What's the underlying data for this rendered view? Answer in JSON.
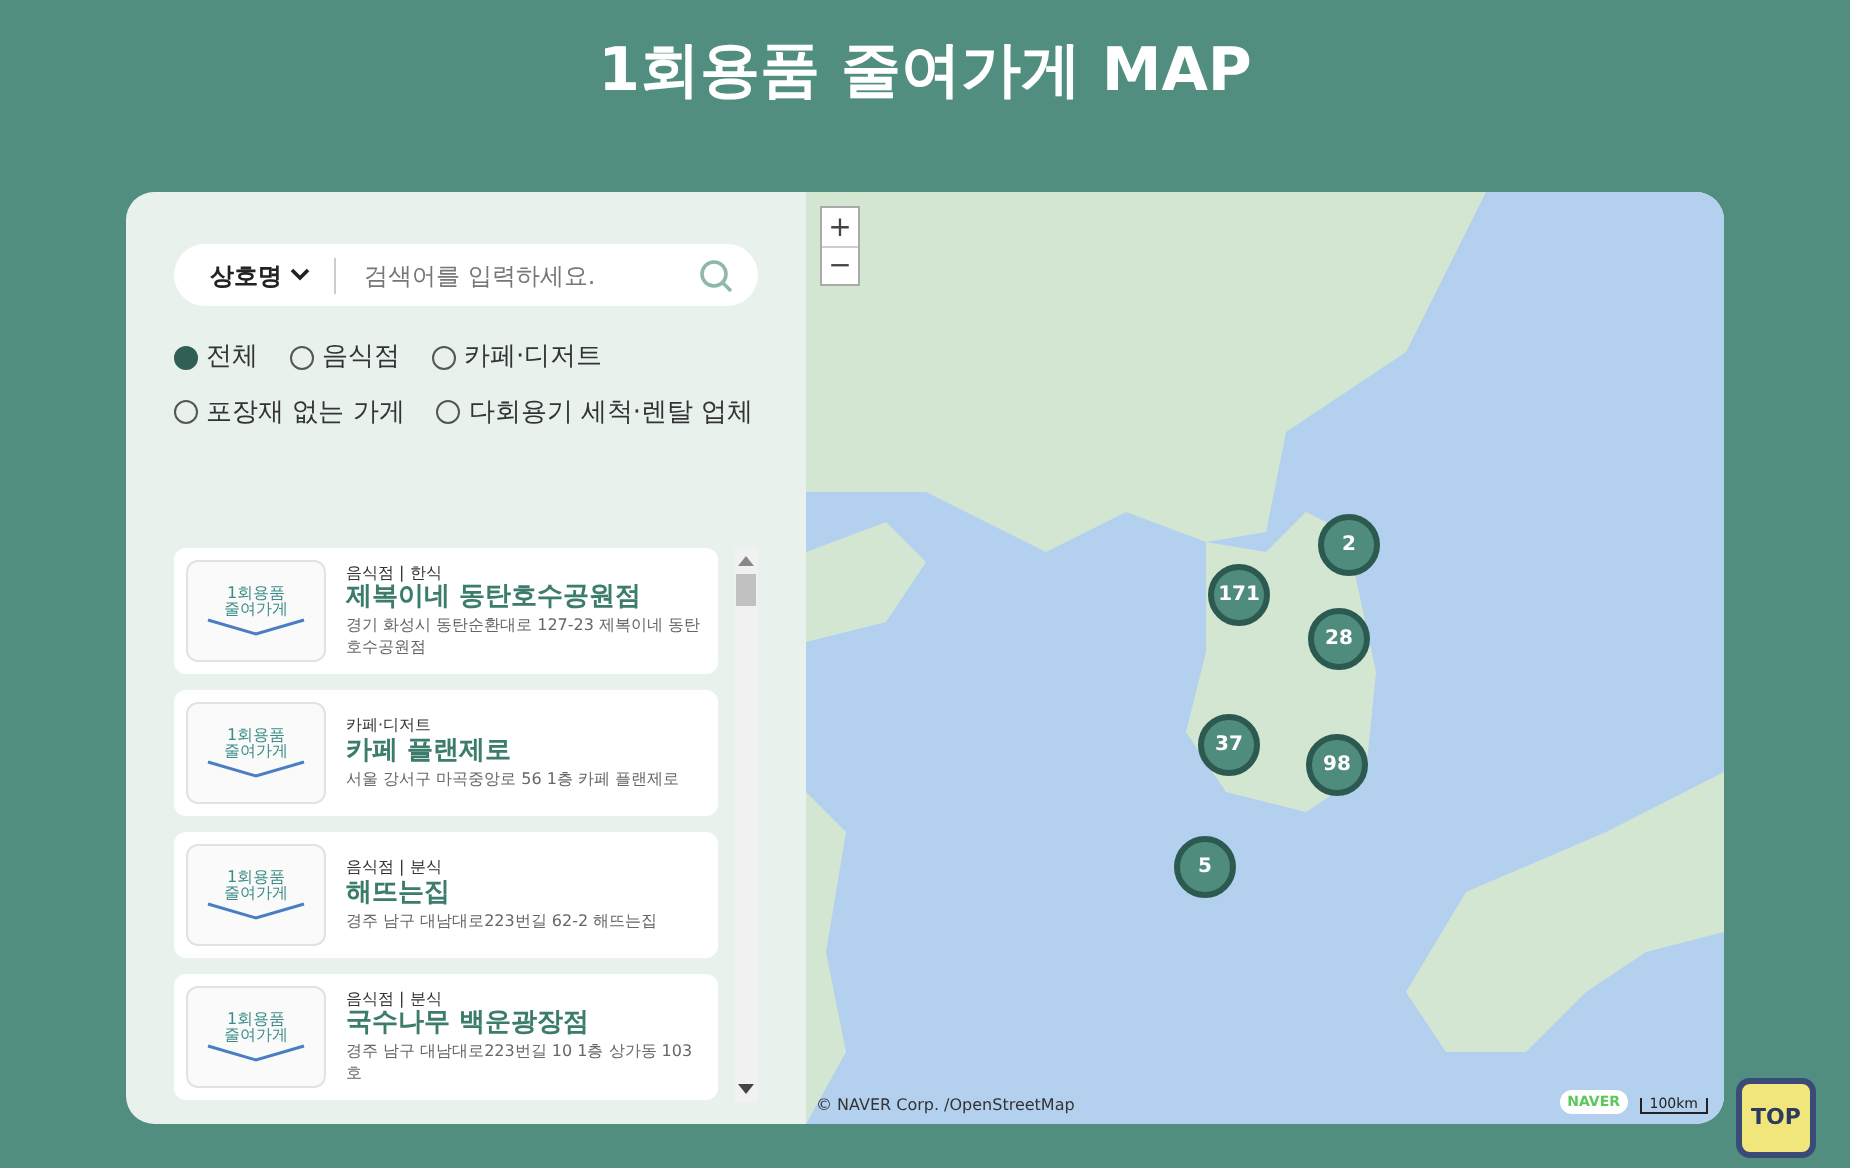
{
  "page_title": "1회용품 줄여가게 MAP",
  "search": {
    "dropdown": "상호명",
    "placeholder": "검색어를 입력하세요."
  },
  "filters": [
    {
      "label": "전체",
      "selected": true
    },
    {
      "label": "음식점",
      "selected": false
    },
    {
      "label": "카페·디저트",
      "selected": false
    },
    {
      "label": "포장재 없는 가게",
      "selected": false
    },
    {
      "label": "다회용기 세척·렌탈 업체",
      "selected": false
    }
  ],
  "stores": [
    {
      "logo_text": [
        "1회용품",
        "줄여가게"
      ],
      "category": "음식점 | 한식",
      "name": "제복이네 동탄호수공원점",
      "address": "경기 화성시 동탄순환대로 127-23 제복이네 동탄호수공원점"
    },
    {
      "logo_text": [
        "1회용품",
        "줄여가게"
      ],
      "category": "카페·디저트",
      "name": "카페 플랜제로",
      "address": "서울 강서구 마곡중앙로 56 1층 카페 플랜제로"
    },
    {
      "logo_text": [
        "1회용품",
        "줄여가게"
      ],
      "category": "음식점 | 분식",
      "name": "해뜨는집",
      "address": "경주 남구 대남대로223번길 62-2 해뜨는집"
    },
    {
      "logo_text": [
        "1회용품",
        "줄여가게"
      ],
      "category": "음식점 | 분식",
      "name": "국수나무 백운광장점",
      "address": "경주 남구 대남대로223번길 10 1층 상가동 103호"
    }
  ],
  "map": {
    "zoom_in": "+",
    "zoom_out": "−",
    "clusters": [
      "2",
      "171",
      "28",
      "37",
      "98",
      "5"
    ],
    "attribution": "© NAVER Corp. /OpenStreetMap",
    "logo": "NAVER",
    "scale": "100km"
  },
  "top_button": "TOP"
}
